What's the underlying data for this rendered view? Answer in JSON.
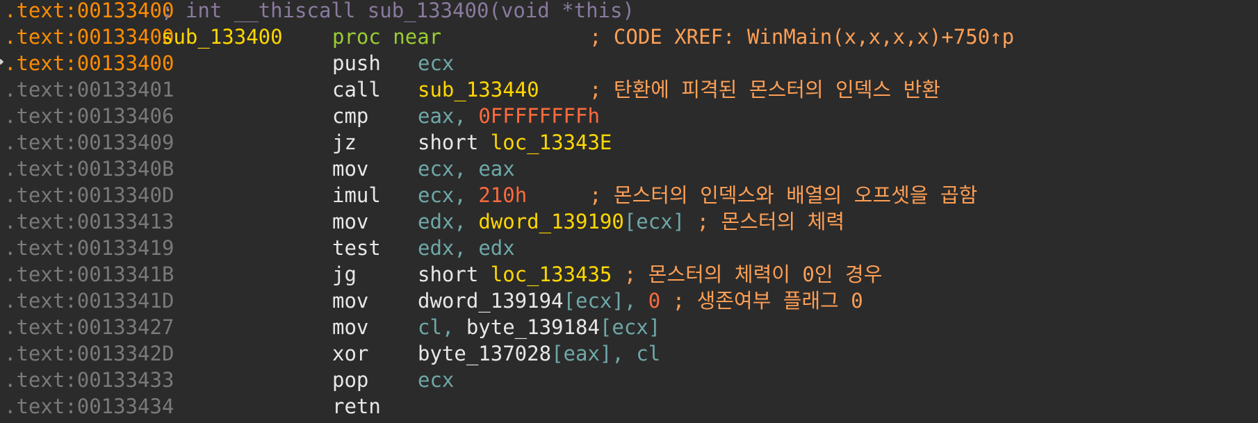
{
  "header": {
    "address": ".text:00133400",
    "comment": "; int __thiscall sub_133400(void *this)"
  },
  "proc_line": {
    "address": ".text:00133400",
    "label": "sub_133400",
    "keyword": "proc near",
    "comment": "; CODE XREF: WinMain(x,x,x,x)+750↑p"
  },
  "lines": [
    {
      "address": ".text:00133400",
      "mnemonic": "push",
      "op1": "ecx"
    },
    {
      "address": ".text:00133401",
      "mnemonic": "call",
      "op1": "sub_133440",
      "comment": "; 탄환에 피격된 몬스터의 인덱스 반환"
    },
    {
      "address": ".text:00133406",
      "mnemonic": "cmp",
      "op1": "eax",
      "sep": ", ",
      "op2": "0FFFFFFFFh"
    },
    {
      "address": ".text:00133409",
      "mnemonic": "jz",
      "op1": "short ",
      "op2": "loc_13343E"
    },
    {
      "address": ".text:0013340B",
      "mnemonic": "mov",
      "op1": "ecx",
      "sep": ", ",
      "op2": "eax"
    },
    {
      "address": ".text:0013340D",
      "mnemonic": "imul",
      "op1": "ecx",
      "sep": ", ",
      "op2": "210h",
      "comment": "; 몬스터의 인덱스와 배열의 오프셋을 곱함"
    },
    {
      "address": ".text:00133413",
      "mnemonic": "mov",
      "op1": "edx",
      "sep": ", ",
      "op2a": "dword_139190",
      "op2b": "[",
      "op2c": "ecx",
      "op2d": "]",
      "comment": " ; 몬스터의 체력"
    },
    {
      "address": ".text:00133419",
      "mnemonic": "test",
      "op1": "edx",
      "sep": ", ",
      "op2": "edx"
    },
    {
      "address": ".text:0013341B",
      "mnemonic": "jg",
      "op1": "short ",
      "op2": "loc_133435",
      "comment": " ; 몬스터의 체력이 0인 경우"
    },
    {
      "address": ".text:0013341D",
      "mnemonic": "mov",
      "op1a": "dword_139194",
      "op1b": "[",
      "op1c": "ecx",
      "op1d": "]",
      "sep": ", ",
      "op2": "0",
      "comment": " ; 생존여부 플래그 0"
    },
    {
      "address": ".text:00133427",
      "mnemonic": "mov",
      "op1": "cl",
      "sep": ", ",
      "op2a": "byte_139184",
      "op2b": "[",
      "op2c": "ecx",
      "op2d": "]"
    },
    {
      "address": ".text:0013342D",
      "mnemonic": "xor",
      "op1a": "byte_137028",
      "op1b": "[",
      "op1c": "eax",
      "op1d": "]",
      "sep": ", ",
      "op2": "cl"
    },
    {
      "address": ".text:00133433",
      "mnemonic": "pop",
      "op1": "ecx"
    },
    {
      "address": ".text:00133434",
      "mnemonic": "retn"
    }
  ],
  "colors": {
    "background": "#2b2b2b",
    "address_highlight": "#ff8c00",
    "address_dim": "#7a7a7a",
    "register": "#6fa8a8",
    "number": "#ff6a3d",
    "symbol": "#ffd700",
    "comment": "#ff9f55",
    "keyword": "#9acd32"
  }
}
